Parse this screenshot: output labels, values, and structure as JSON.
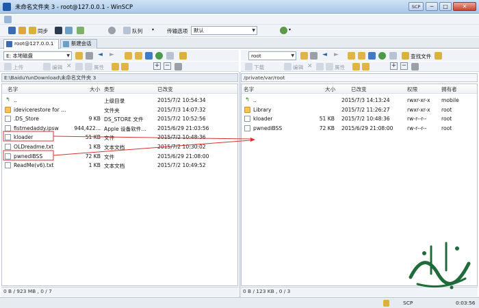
{
  "window": {
    "title": "未命名文件夹 3 - root@127.0.0.1 - WinSCP",
    "help_glyph": "SCP",
    "min_glyph": "─",
    "max_glyph": "□",
    "close_glyph": "✕"
  },
  "toolbar": {
    "sync_label": "同步",
    "queue_label": "队列",
    "transfer_options_label": "传输选项",
    "transfer_preset": "默认"
  },
  "tabs": [
    {
      "label": "root@127.0.0.1"
    },
    {
      "label": "新建会话"
    }
  ],
  "left_panel": {
    "drive": "E: 本地磁盘",
    "ops": {
      "upload": "上传",
      "edit": "编辑",
      "properties": "属性"
    },
    "path": "E:\\BaiduYunDownload\\未命名文件夹 3",
    "columns": [
      "名字",
      "大小",
      "类型",
      "已改变"
    ],
    "rows": [
      {
        "name": "..",
        "size": "",
        "type": "上级目录",
        "changed": "2015/7/2  10:54:34",
        "icon": "up-icon"
      },
      {
        "name": "idevicerestore for ...",
        "size": "",
        "type": "文件夹",
        "changed": "2015/7/3  14:07:32",
        "icon": "folder-icon"
      },
      {
        "name": ".DS_Store",
        "size": "9 KB",
        "type": "DS_STORE 文件",
        "changed": "2015/7/2  10:52:56",
        "icon": "file-icon"
      },
      {
        "name": "fistmedaddy.ipsw",
        "size": "944,422...",
        "type": "Apple 设备软件...",
        "changed": "2015/6/29  21:03:56",
        "icon": "file-icon"
      },
      {
        "name": "kloader",
        "size": "51 KB",
        "type": "文件",
        "changed": "2015/7/2  10:48:36",
        "icon": "file-icon"
      },
      {
        "name": "OLDreadme.txt",
        "size": "1 KB",
        "type": "文本文档",
        "changed": "2015/7/2  10:30:02",
        "icon": "file-icon"
      },
      {
        "name": "pwnediBSS",
        "size": "72 KB",
        "type": "文件",
        "changed": "2015/6/29  21:08:00",
        "icon": "file-icon"
      },
      {
        "name": "ReadMe(v6).txt",
        "size": "1 KB",
        "type": "文本文档",
        "changed": "2015/7/2  10:49:52",
        "icon": "file-icon"
      }
    ],
    "status": "0 B / 923 MB , 0 / 7"
  },
  "right_panel": {
    "dir": "root",
    "find_label": "查找文件",
    "ops": {
      "download": "下载",
      "edit": "编辑",
      "properties": "属性"
    },
    "path": "/private/var/root",
    "columns": [
      "名字",
      "大小",
      "已改变",
      "权限",
      "拥有者"
    ],
    "rows": [
      {
        "name": "..",
        "size": "",
        "changed": "2015/7/3 14:13:24",
        "rights": "rwxr-xr-x",
        "owner": "mobile",
        "icon": "up-icon"
      },
      {
        "name": "Library",
        "size": "",
        "changed": "2015/7/2 11:26:27",
        "rights": "rwxr-xr-x",
        "owner": "root",
        "icon": "folder-icon"
      },
      {
        "name": "kloader",
        "size": "51 KB",
        "changed": "2015/7/2 10:48:36",
        "rights": "rw-r--r--",
        "owner": "root",
        "icon": "file-icon"
      },
      {
        "name": "pwnediBSS",
        "size": "72 KB",
        "changed": "2015/6/29 21:08:00",
        "rights": "rw-r--r--",
        "owner": "root",
        "icon": "file-icon"
      }
    ],
    "status": "0 B / 123 KB , 0 / 3"
  },
  "statusbar": {
    "protocol": "SCP",
    "elapsed": "0:03:56"
  },
  "annotation_color": "#d93030",
  "watermark_text": "ثاقوري"
}
